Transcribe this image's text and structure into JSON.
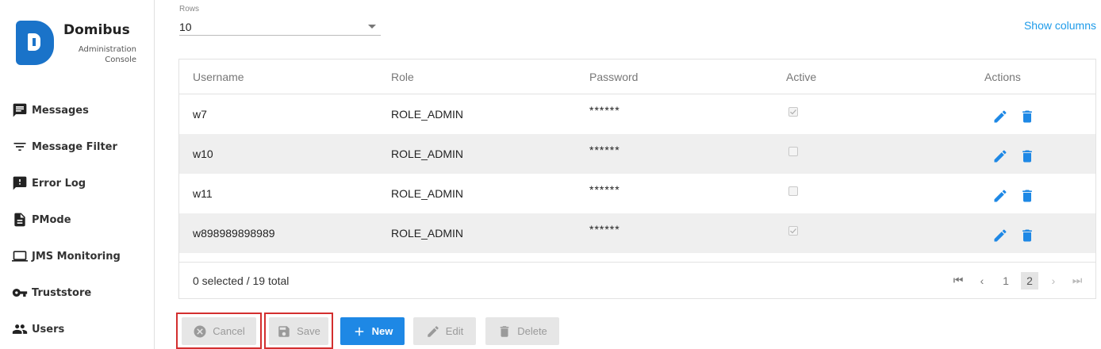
{
  "brand": {
    "title": "Domibus",
    "subtitle": "Administration Console"
  },
  "sidebar": {
    "items": [
      {
        "label": "Messages",
        "icon": "message-icon"
      },
      {
        "label": "Message Filter",
        "icon": "filter-icon"
      },
      {
        "label": "Error Log",
        "icon": "error-log-icon"
      },
      {
        "label": "PMode",
        "icon": "document-icon"
      },
      {
        "label": "JMS Monitoring",
        "icon": "laptop-icon"
      },
      {
        "label": "Truststore",
        "icon": "key-icon"
      },
      {
        "label": "Users",
        "icon": "users-icon"
      }
    ]
  },
  "rows": {
    "label": "Rows",
    "value": "10"
  },
  "show_columns": "Show columns",
  "table": {
    "headers": [
      "Username",
      "Role",
      "Password",
      "Active",
      "Actions"
    ],
    "rows": [
      {
        "username": "w7",
        "role": "ROLE_ADMIN",
        "password": "******",
        "active": true
      },
      {
        "username": "w10",
        "role": "ROLE_ADMIN",
        "password": "******",
        "active": false
      },
      {
        "username": "w11",
        "role": "ROLE_ADMIN",
        "password": "******",
        "active": false
      },
      {
        "username": "w898989898989",
        "role": "ROLE_ADMIN",
        "password": "******",
        "active": true
      }
    ],
    "footer": {
      "count": "0 selected / 19 total",
      "pages": [
        "1",
        "2"
      ],
      "current_page": "2"
    }
  },
  "buttons": {
    "cancel": "Cancel",
    "save": "Save",
    "new": "New",
    "edit": "Edit",
    "delete": "Delete"
  },
  "colors": {
    "accent": "#1e88e5",
    "link": "#1e9be9",
    "highlight": "#d32f2f"
  }
}
